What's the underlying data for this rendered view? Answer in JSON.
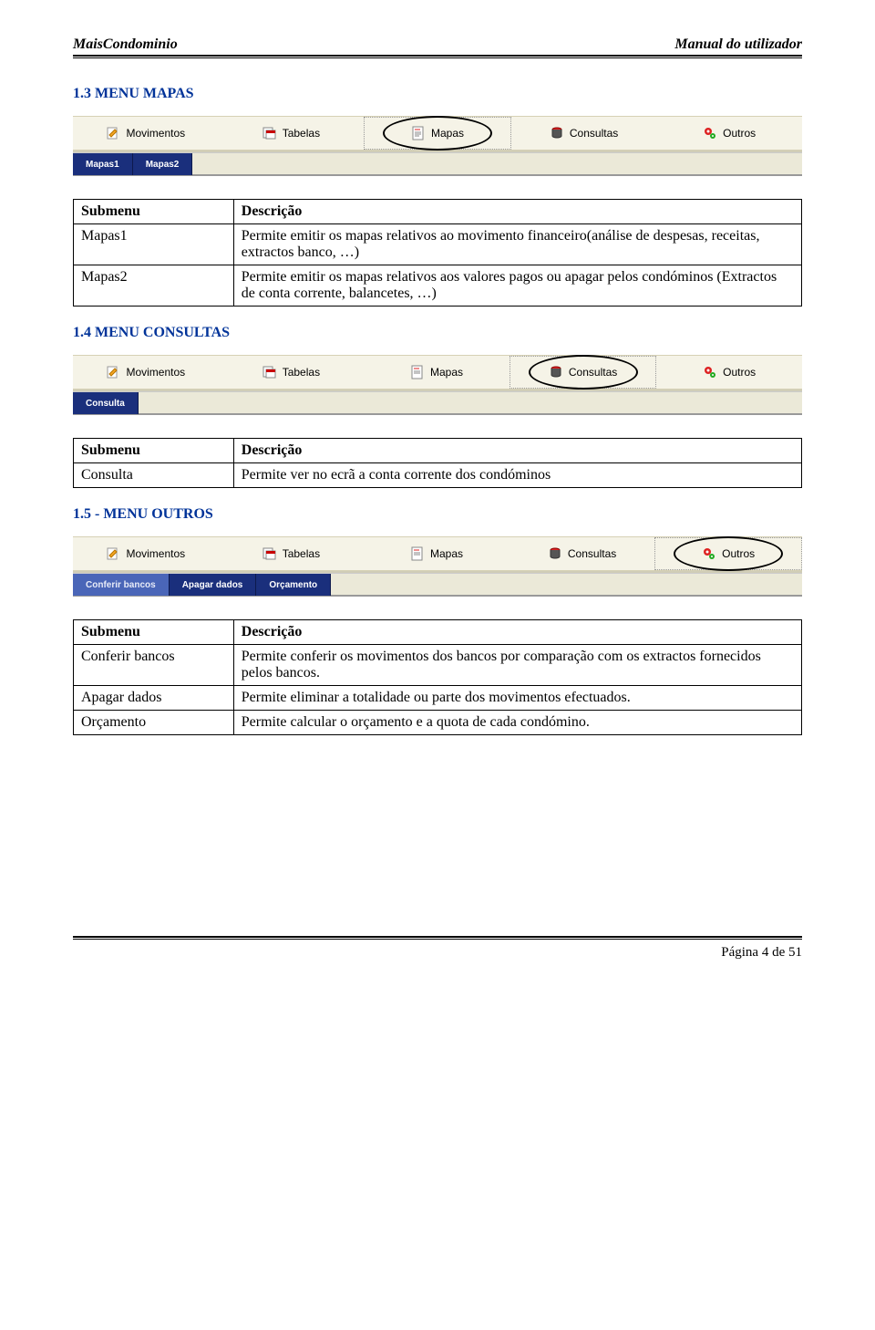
{
  "header": {
    "left": "MaisCondominio",
    "right": "Manual do utilizador"
  },
  "sections": {
    "mapas": {
      "title": "1.3 MENU MAPAS"
    },
    "consultas": {
      "title": "1.4 MENU CONSULTAS"
    },
    "outros": {
      "title": "1.5 - MENU OUTROS"
    }
  },
  "menubar": {
    "movimentos": "Movimentos",
    "tabelas": "Tabelas",
    "mapas": "Mapas",
    "consultas": "Consultas",
    "outros": "Outros"
  },
  "submenu": {
    "mapas1": "Mapas1",
    "mapas2": "Mapas2",
    "consulta": "Consulta",
    "conferir": "Conferir bancos",
    "apagar": "Apagar dados",
    "orcamento": "Orçamento"
  },
  "table_headers": {
    "submenu": "Submenu",
    "descricao": "Descrição"
  },
  "tables": {
    "mapas": {
      "row1": {
        "label": "Mapas1",
        "desc": "Permite emitir os mapas relativos ao movimento financeiro(análise de despesas, receitas, extractos banco, …)"
      },
      "row2": {
        "label": "Mapas2",
        "desc": "Permite emitir os mapas relativos aos valores pagos ou apagar pelos condóminos (Extractos de conta corrente, balancetes, …)"
      }
    },
    "consultas": {
      "row1": {
        "label": "Consulta",
        "desc": "Permite ver no ecrã a conta corrente dos condóminos"
      }
    },
    "outros": {
      "row1": {
        "label": "Conferir bancos",
        "desc": "Permite conferir os movimentos dos bancos por comparação com os extractos fornecidos pelos bancos."
      },
      "row2": {
        "label": "Apagar dados",
        "desc": "Permite eliminar a totalidade ou parte dos movimentos efectuados."
      },
      "row3": {
        "label": "Orçamento",
        "desc": "Permite calcular o orçamento e a quota de cada condómino."
      }
    }
  },
  "footer": {
    "page": "Página 4 de 51"
  }
}
